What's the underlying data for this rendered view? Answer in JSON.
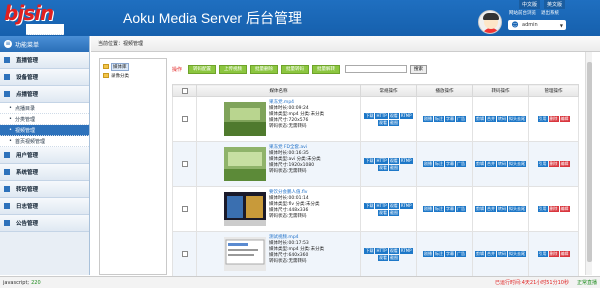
{
  "header": {
    "logo_text": "bjsin",
    "logo_sub": "北极星通",
    "title": "Aoku Media Server 后台管理",
    "lang": [
      "中文版",
      "英文版"
    ],
    "links": [
      "网站前台浏览",
      "退出系统"
    ],
    "username": "admin"
  },
  "sidebar": {
    "head": "功能菜单",
    "groups_top": [
      "直播管理",
      "设备管理",
      "点播管理"
    ],
    "subs": [
      {
        "label": "点播目录",
        "active": false
      },
      {
        "label": "分类管理",
        "active": false
      },
      {
        "label": "视频管理",
        "active": true
      },
      {
        "label": "首页视频管理",
        "active": false
      }
    ],
    "groups_bottom": [
      "用户管理",
      "系统管理",
      "转码管理",
      "日志管理",
      "公告管理"
    ]
  },
  "breadcrumb": "当前位置：视频管理",
  "tree": [
    {
      "label": "媒体库",
      "selected": true
    },
    {
      "label": "录像分类",
      "selected": false
    }
  ],
  "toolbar": {
    "label": "操作",
    "buttons": [
      "转码配置",
      "上传视频",
      "批量删除",
      "批量转码",
      "批量解转"
    ],
    "search_placeholder": "",
    "search_button": "搜索"
  },
  "table": {
    "headers": [
      "",
      "媒体名称",
      "常规操作",
      "播放操作",
      "转码操作",
      "管理操作"
    ],
    "rows": [
      {
        "name": "果冻党.mp4",
        "duration": "媒体时长:00:09:24",
        "type": "媒体类型:mp4",
        "category": "分类:未分类",
        "size": "媒体尺寸:720x576",
        "status": "转码状态:无需转码"
      },
      {
        "name": "果冻党 FD全套.avi",
        "duration": "媒体时长:00:16:35",
        "type": "媒体类型:avi",
        "category": "分类:未分类",
        "size": "媒体尺寸:1920x1080",
        "status": "转码状态:无需转码"
      },
      {
        "name": "要饮分会鹏人值.flv",
        "duration": "媒体时长:00:01:14",
        "type": "媒体类型:flv",
        "category": "分类:未分类",
        "size": "媒体尺寸:448x336",
        "status": "转码状态:无需转码"
      },
      {
        "name": "测试视频.mp4",
        "duration": "媒体时长:00:17:53",
        "type": "媒体类型:mp4",
        "category": "分类:未分类",
        "size": "媒体尺寸:640x360",
        "status": "转码状态:无需转码"
      }
    ],
    "ops_regular": [
      "下载",
      "HTTP",
      "观看",
      "RTMP",
      "观看",
      "截图"
    ],
    "ops_play": [
      "剧播",
      "标注",
      "字幕",
      "广告"
    ],
    "ops_transcode": [
      "剪辑",
      "合并",
      "转码",
      "拟头去尾"
    ],
    "ops_manage": [
      "引用",
      "删除",
      "编辑"
    ]
  },
  "status": {
    "js_label": "javascript;",
    "js_value": "220",
    "run_time": "已运行时间:4天21小时51分10秒",
    "state": "正常直播"
  },
  "colors": {
    "header": "#1b66b4",
    "green_btn": "#8cc63f",
    "op_btn": "#1e78c8",
    "red": "#e02020"
  }
}
